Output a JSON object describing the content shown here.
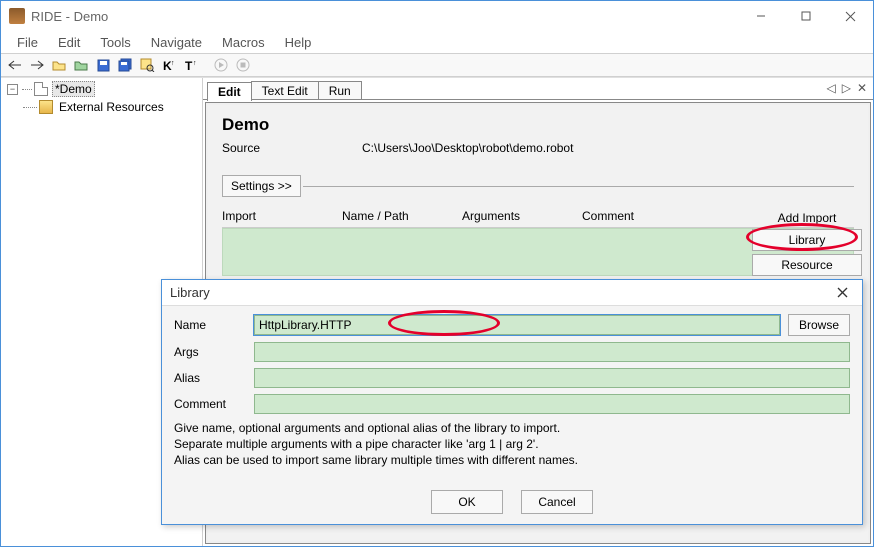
{
  "window": {
    "title": "RIDE - Demo"
  },
  "menu": {
    "file": "File",
    "edit": "Edit",
    "tools": "Tools",
    "navigate": "Navigate",
    "macros": "Macros",
    "help": "Help"
  },
  "tree": {
    "item1": "*Demo",
    "item2": "External Resources"
  },
  "tabs": {
    "edit": "Edit",
    "text": "Text Edit",
    "run": "Run"
  },
  "editor": {
    "title": "Demo",
    "source_label": "Source",
    "source_path": "C:\\Users\\Joo\\Desktop\\robot\\demo.robot",
    "settings_btn": "Settings >>",
    "cols": {
      "import": "Import",
      "name": "Name / Path",
      "args": "Arguments",
      "comment": "Comment"
    }
  },
  "import_panel": {
    "title": "Add Import",
    "library": "Library",
    "resource": "Resource"
  },
  "dialog": {
    "title": "Library",
    "name_label": "Name",
    "name_value": "HttpLibrary.HTTP",
    "args_label": "Args",
    "alias_label": "Alias",
    "comment_label": "Comment",
    "browse": "Browse",
    "help1": "Give name, optional arguments and optional alias of the library to import.",
    "help2": "Separate multiple arguments with a pipe character like 'arg 1 | arg 2'.",
    "help3": "Alias can be used to import same library multiple times with different names.",
    "ok": "OK",
    "cancel": "Cancel"
  }
}
